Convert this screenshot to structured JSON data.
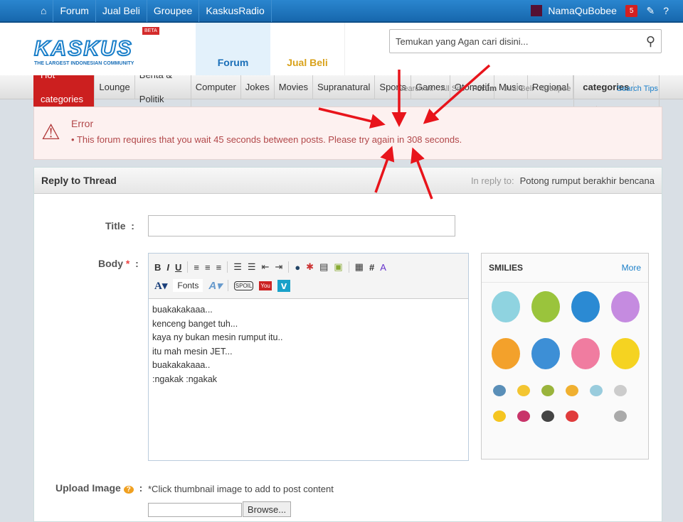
{
  "topbar": {
    "links": [
      "Forum",
      "Jual Beli",
      "Groupee",
      "KaskusRadio"
    ],
    "username": "NamaQuBobee",
    "notifications": "5"
  },
  "header": {
    "logo": "KASKUS",
    "tagline": "THE LARGEST INDONESIAN COMMUNITY",
    "beta": "BETA",
    "tabs": [
      "Forum",
      "Jual Beli"
    ],
    "search_placeholder": "Temukan yang Agan cari disini...",
    "search_in_label": "Search in:",
    "search_in": [
      "All Site",
      "Forum",
      "Jual Beli",
      "Groupee"
    ],
    "search_tips": "Search Tips"
  },
  "nav": {
    "hot": "Hot categories",
    "items": [
      "Lounge",
      "Berita & Politik",
      "Computer",
      "Jokes",
      "Movies",
      "Supranatural",
      "Sports",
      "Games",
      "Otomotif",
      "Music",
      "Regional"
    ],
    "all": "All categories"
  },
  "error": {
    "title": "Error",
    "message": "This forum requires that you wait 45 seconds between posts. Please try again in 308 seconds."
  },
  "reply": {
    "heading": "Reply to Thread",
    "in_reply_label": "In reply to:",
    "thread": "Potong rumput berakhir bencana",
    "title_label": "Title",
    "body_label": "Body",
    "required": "*",
    "fonts": "Fonts",
    "body_text": "buakakakaaa...\nkenceng banget tuh...\nkaya ny bukan mesin rumput itu..\nitu mah mesin JET...\nbuakakakaaa..\n:ngakak :ngakak",
    "smilies_title": "SMILIES",
    "smilies_more": "More",
    "upload_label": "Upload Image",
    "upload_note": "*Click thumbnail image to add to post content",
    "browse": "Browse..."
  },
  "colors": {
    "topbar": "#1767ad",
    "hot": "#cc1f1f",
    "error_text": "#b2484a",
    "annotation_arrows": "#e8141b"
  }
}
